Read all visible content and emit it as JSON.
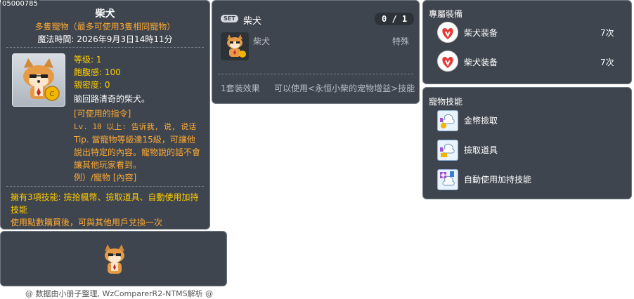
{
  "item": {
    "id": "05000785",
    "name": "柴犬",
    "subtitle": "多隻寵物（最多可使用3隻相同寵物）",
    "magic_time": "魔法時間: 2026年9月3日14時11分",
    "stats": {
      "level": "等级: 1",
      "fullness": "飽腹感: 100",
      "closeness": "親密度: 0"
    },
    "desc": "脑回路清奇的柴犬。",
    "commands_title": "[可使用的指令]",
    "commands": [
      "Lv. 10 以上: 告诉我, 说, 说话",
      "Tip. 當寵物等級達15級，可讓他",
      "說出特定的內容。寵物說的話不會",
      "讓其他玩家看到。",
      "例）/寵物 [內容]"
    ],
    "skills_note": [
      "擁有3項技能: 撿拾楓幣、撿取道具、自動使用加持",
      "技能"
    ],
    "trade_note": "使用點數購買後，可與其他用戶兌換一次"
  },
  "set": {
    "badge": "SET",
    "name": "柴犬",
    "count": "0 / 1",
    "member_name": "柴犬",
    "member_type": "特殊",
    "effect_label": "1套装效果",
    "effect_desc": "可以使用<永恒小柴的宠物增益>技能"
  },
  "exclusive": {
    "title": "專屬裝備",
    "items": [
      {
        "name": "柴犬装备",
        "count": "7次"
      },
      {
        "name": "柴犬装备",
        "count": "7次"
      }
    ]
  },
  "pet_skills": {
    "title": "寵物技能",
    "items": [
      {
        "name": "金幣撿取",
        "icon": "coin-pickup-icon"
      },
      {
        "name": "撿取道具",
        "icon": "item-pickup-icon"
      },
      {
        "name": "自動使用加持技能",
        "icon": "auto-buff-icon"
      }
    ]
  },
  "footer": "@ 数据由小册子整理, WzComparerR2-NTMS解析 @"
}
